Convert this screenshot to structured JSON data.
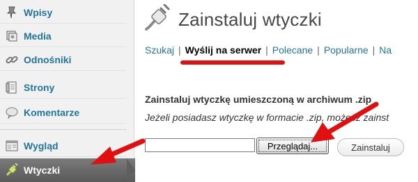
{
  "sidebar": {
    "items": [
      {
        "label": "Wpisy",
        "icon": "pushpin-icon",
        "active": false
      },
      {
        "label": "Media",
        "icon": "media-icon",
        "active": false
      },
      {
        "label": "Odnośniki",
        "icon": "link-icon",
        "active": false
      },
      {
        "label": "Strony",
        "icon": "page-icon",
        "active": false
      },
      {
        "label": "Komentarze",
        "icon": "comment-icon",
        "active": false
      },
      {
        "label": "Wygląd",
        "icon": "appearance-icon",
        "active": false
      },
      {
        "label": "Wtyczki",
        "icon": "plugin-icon",
        "active": true
      }
    ]
  },
  "header": {
    "title": "Zainstaluj wtyczki",
    "icon": "plugin-plug-icon"
  },
  "tabs": [
    {
      "label": "Szukaj",
      "current": false
    },
    {
      "label": "Wyślij na serwer",
      "current": true
    },
    {
      "label": "Polecane",
      "current": false
    },
    {
      "label": "Popularne",
      "current": false
    },
    {
      "label": "Na",
      "current": false
    }
  ],
  "upload": {
    "heading": "Zainstaluj wtyczkę umieszczoną w archiwum .zip",
    "description": "Jeżeli posiadasz wtyczkę w formacie .zip, możesz zainst",
    "file_value": "",
    "browse_label": "Przeglądaj...",
    "install_label": "Zainstaluj"
  },
  "colors": {
    "link": "#21759b",
    "annotation_red": "#e01010",
    "active_menu": "#666666"
  }
}
